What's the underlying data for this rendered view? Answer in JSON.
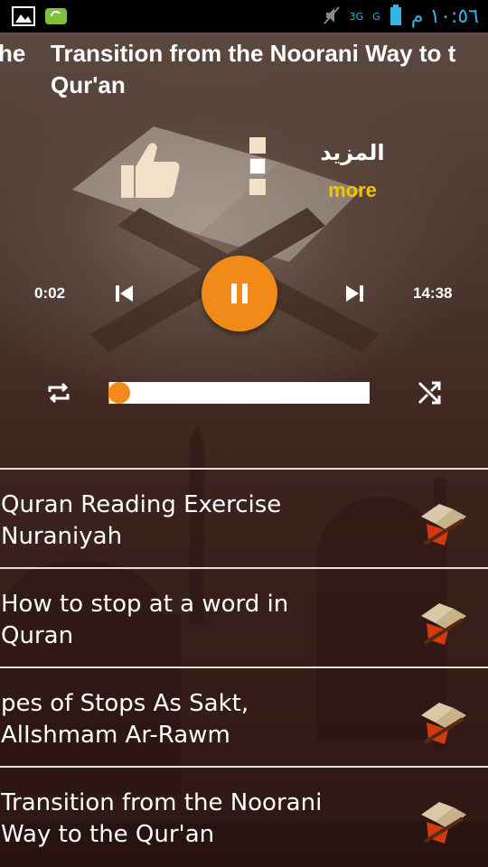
{
  "status_bar": {
    "clock": "١٠:٥٦ م",
    "network_labels": [
      "3G",
      "G"
    ]
  },
  "header": {
    "title_prev_fragment": "he",
    "title_line1": "Transition from the Noorani Way to t",
    "title_line2": "Qur'an"
  },
  "more": {
    "arabic_label": "المزيد",
    "label": "more"
  },
  "player": {
    "current_time": "0:02",
    "total_time": "14:38",
    "progress": 0.003,
    "state": "playing",
    "accent_color": "#f28a1a"
  },
  "playlist": [
    {
      "line1": "Quran Reading Exercise",
      "line2": "Nuraniyah"
    },
    {
      "line1": "How to stop at a word in",
      "line2": "Quran"
    },
    {
      "line1": "pes of Stops As Sakt,",
      "line2": "AlIshmam  Ar-Rawm"
    },
    {
      "line1": "Transition from the Noorani",
      "line2": "Way to the Qur'an"
    }
  ],
  "icons": {
    "like": "thumbs-up-icon",
    "menu": "menu-dots-icon",
    "prev": "skip-previous-icon",
    "next": "skip-next-icon",
    "play": "pause-icon",
    "repeat": "repeat-icon",
    "shuffle": "shuffle-icon",
    "list": "quran-book-icon"
  }
}
